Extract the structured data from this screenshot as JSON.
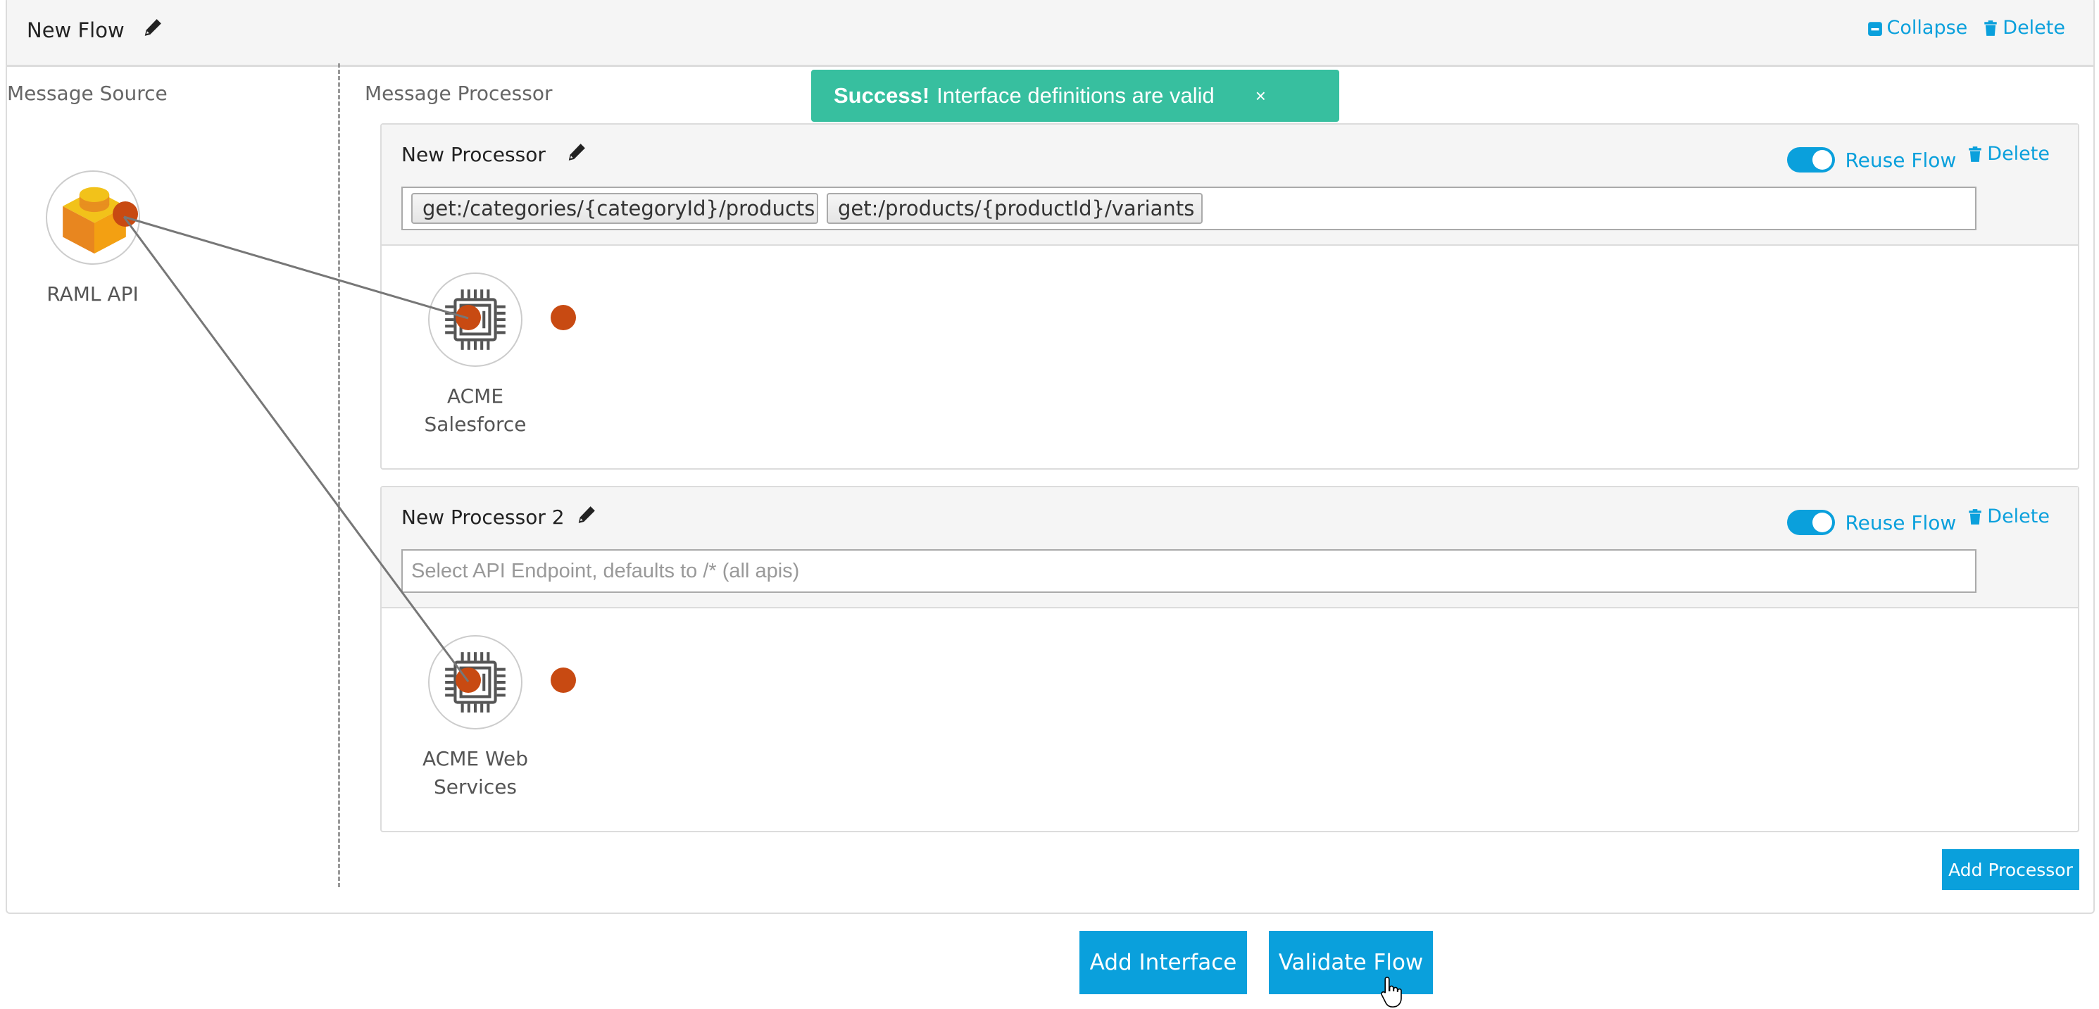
{
  "flow": {
    "title": "New Flow",
    "actions": {
      "collapse": "Collapse",
      "delete": "Delete"
    },
    "source_column_label": "Message Source",
    "processor_column_label": "Message Processor"
  },
  "toast": {
    "strong": "Success!",
    "message": "Interface definitions are valid",
    "close": "×",
    "color": "#37bf9f"
  },
  "source_node": {
    "label": "RAML API",
    "icon": "lego-brick-icon"
  },
  "processors": [
    {
      "title": "New Processor",
      "reuse_flow_label": "Reuse Flow",
      "reuse_flow_on": true,
      "delete_label": "Delete",
      "endpoints": [
        "get:/categories/{categoryId}/products",
        "get:/products/{productId}/variants"
      ],
      "endpoint_placeholder": "",
      "node": {
        "label_line1": "ACME",
        "label_line2": "Salesforce",
        "icon": "chip-icon"
      }
    },
    {
      "title": "New Processor 2",
      "reuse_flow_label": "Reuse Flow",
      "reuse_flow_on": true,
      "delete_label": "Delete",
      "endpoints": [],
      "endpoint_placeholder": "Select API Endpoint, defaults to /* (all apis)",
      "node": {
        "label_line1": "ACME Web",
        "label_line2": "Services",
        "icon": "chip-icon"
      }
    }
  ],
  "buttons": {
    "add_processor": "Add Processor",
    "add_interface": "Add Interface",
    "validate_flow": "Validate Flow"
  },
  "colors": {
    "accent": "#0aa0dc",
    "port": "#c84a12",
    "success": "#37bf9f"
  }
}
